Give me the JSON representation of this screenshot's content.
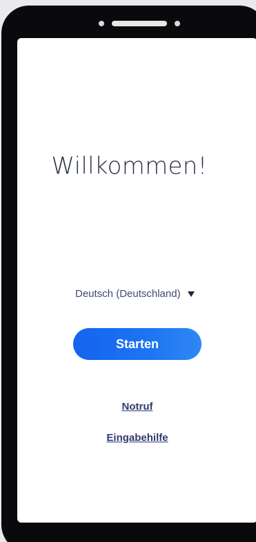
{
  "welcome": {
    "title": "Willkommen!"
  },
  "language": {
    "selected": "Deutsch (Deutschland)"
  },
  "actions": {
    "start_label": "Starten",
    "emergency_label": "Notruf",
    "accessibility_label": "Eingabehilfe"
  },
  "colors": {
    "accent": "#1463f0",
    "text_dark": "#2c3245",
    "link": "#2f3b6c"
  }
}
